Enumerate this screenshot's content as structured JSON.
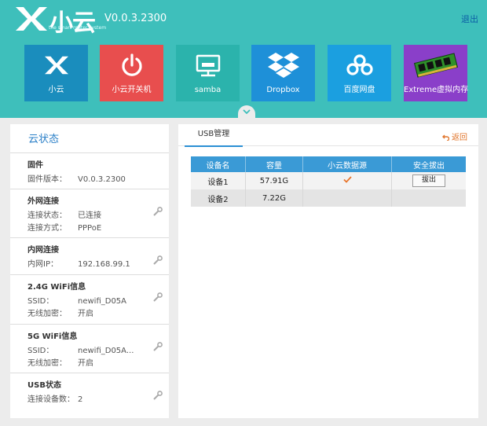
{
  "header": {
    "brand": "小云",
    "tagline": "the smart router system",
    "version": "V0.0.3.2300",
    "logout": "退出"
  },
  "tiles": [
    {
      "label": "小云",
      "icon": "xiaoyun-logo-icon",
      "color": "#1a8dbd"
    },
    {
      "label": "小云开关机",
      "icon": "power-icon",
      "color": "#e84e4e"
    },
    {
      "label": "samba",
      "icon": "network-drive-icon",
      "color": "#2bb3ac"
    },
    {
      "label": "Dropbox",
      "icon": "dropbox-icon",
      "color": "#1e90d8"
    },
    {
      "label": "百度网盘",
      "icon": "baidu-cloud-icon",
      "color": "#1b9fe0"
    },
    {
      "label": "Extreme虚拟内存",
      "icon": "memory-chip-icon",
      "color": "#8a3fc9"
    }
  ],
  "status": {
    "title": "云状态",
    "firmware": {
      "heading": "固件",
      "version_label": "固件版本：",
      "version_value": "V0.0.3.2300"
    },
    "wan": {
      "heading": "外网连接",
      "state_label": "连接状态：",
      "state_value": "已连接",
      "mode_label": "连接方式：",
      "mode_value": "PPPoE"
    },
    "lan": {
      "heading": "内网连接",
      "ip_label": "内网IP：",
      "ip_value": "192.168.99.1"
    },
    "wifi24": {
      "heading": "2.4G WiFi信息",
      "ssid_label": "SSID：",
      "ssid_value": "newifi_D05A",
      "enc_label": "无线加密：",
      "enc_value": "开启"
    },
    "wifi5": {
      "heading": "5G WiFi信息",
      "ssid_label": "SSID：",
      "ssid_value": "newifi_D05A...",
      "enc_label": "无线加密：",
      "enc_value": "开启"
    },
    "usb": {
      "heading": "USB状态",
      "count_label": "连接设备数：",
      "count_value": "2"
    }
  },
  "usb_manager": {
    "tab": "USB管理",
    "back": "返回",
    "columns": [
      "设备名",
      "容量",
      "小云数据源",
      "安全拔出"
    ],
    "devices": [
      {
        "name": "设备1",
        "capacity": "57.91G",
        "eject": "拔出"
      },
      {
        "name": "设备2",
        "capacity": "7.22G"
      }
    ]
  },
  "colors": {
    "header_bg": "#3ebfbb",
    "accent_blue": "#3a9ad6",
    "check_orange": "#e8742a"
  }
}
